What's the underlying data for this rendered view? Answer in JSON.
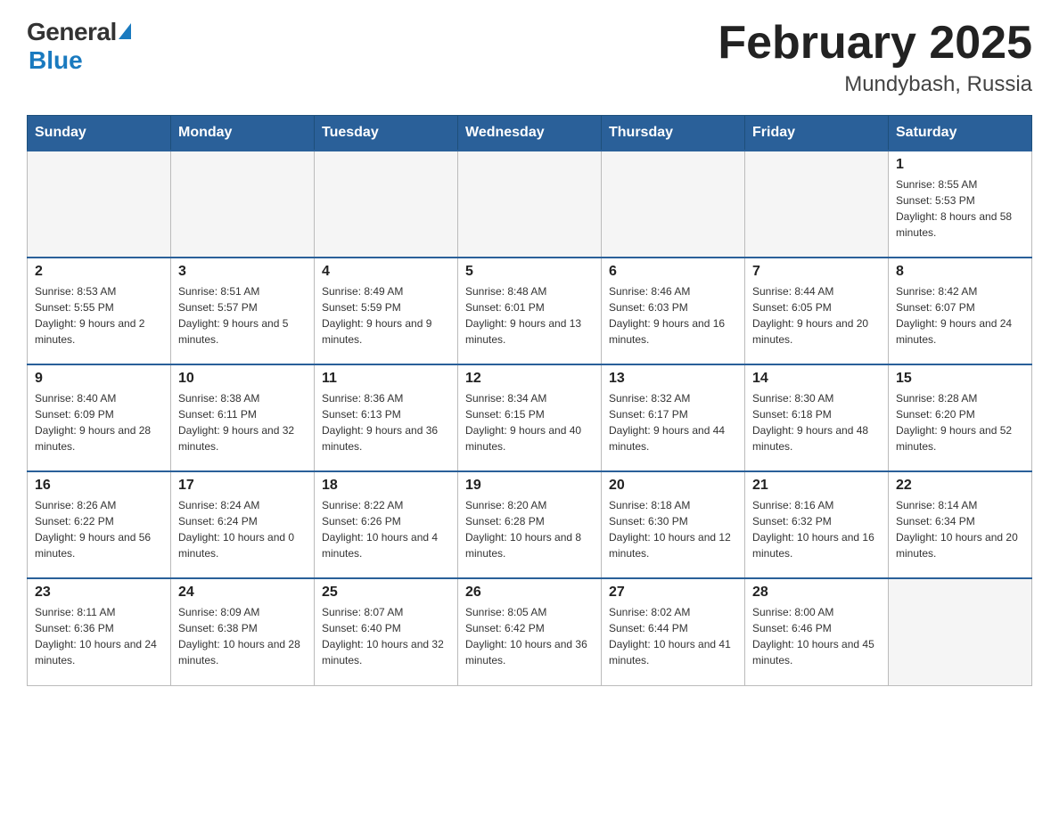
{
  "header": {
    "logo_general": "General",
    "logo_blue": "Blue",
    "title": "February 2025",
    "subtitle": "Mundybash, Russia"
  },
  "weekdays": [
    "Sunday",
    "Monday",
    "Tuesday",
    "Wednesday",
    "Thursday",
    "Friday",
    "Saturday"
  ],
  "weeks": [
    [
      {
        "day": "",
        "info": ""
      },
      {
        "day": "",
        "info": ""
      },
      {
        "day": "",
        "info": ""
      },
      {
        "day": "",
        "info": ""
      },
      {
        "day": "",
        "info": ""
      },
      {
        "day": "",
        "info": ""
      },
      {
        "day": "1",
        "info": "Sunrise: 8:55 AM\nSunset: 5:53 PM\nDaylight: 8 hours and 58 minutes."
      }
    ],
    [
      {
        "day": "2",
        "info": "Sunrise: 8:53 AM\nSunset: 5:55 PM\nDaylight: 9 hours and 2 minutes."
      },
      {
        "day": "3",
        "info": "Sunrise: 8:51 AM\nSunset: 5:57 PM\nDaylight: 9 hours and 5 minutes."
      },
      {
        "day": "4",
        "info": "Sunrise: 8:49 AM\nSunset: 5:59 PM\nDaylight: 9 hours and 9 minutes."
      },
      {
        "day": "5",
        "info": "Sunrise: 8:48 AM\nSunset: 6:01 PM\nDaylight: 9 hours and 13 minutes."
      },
      {
        "day": "6",
        "info": "Sunrise: 8:46 AM\nSunset: 6:03 PM\nDaylight: 9 hours and 16 minutes."
      },
      {
        "day": "7",
        "info": "Sunrise: 8:44 AM\nSunset: 6:05 PM\nDaylight: 9 hours and 20 minutes."
      },
      {
        "day": "8",
        "info": "Sunrise: 8:42 AM\nSunset: 6:07 PM\nDaylight: 9 hours and 24 minutes."
      }
    ],
    [
      {
        "day": "9",
        "info": "Sunrise: 8:40 AM\nSunset: 6:09 PM\nDaylight: 9 hours and 28 minutes."
      },
      {
        "day": "10",
        "info": "Sunrise: 8:38 AM\nSunset: 6:11 PM\nDaylight: 9 hours and 32 minutes."
      },
      {
        "day": "11",
        "info": "Sunrise: 8:36 AM\nSunset: 6:13 PM\nDaylight: 9 hours and 36 minutes."
      },
      {
        "day": "12",
        "info": "Sunrise: 8:34 AM\nSunset: 6:15 PM\nDaylight: 9 hours and 40 minutes."
      },
      {
        "day": "13",
        "info": "Sunrise: 8:32 AM\nSunset: 6:17 PM\nDaylight: 9 hours and 44 minutes."
      },
      {
        "day": "14",
        "info": "Sunrise: 8:30 AM\nSunset: 6:18 PM\nDaylight: 9 hours and 48 minutes."
      },
      {
        "day": "15",
        "info": "Sunrise: 8:28 AM\nSunset: 6:20 PM\nDaylight: 9 hours and 52 minutes."
      }
    ],
    [
      {
        "day": "16",
        "info": "Sunrise: 8:26 AM\nSunset: 6:22 PM\nDaylight: 9 hours and 56 minutes."
      },
      {
        "day": "17",
        "info": "Sunrise: 8:24 AM\nSunset: 6:24 PM\nDaylight: 10 hours and 0 minutes."
      },
      {
        "day": "18",
        "info": "Sunrise: 8:22 AM\nSunset: 6:26 PM\nDaylight: 10 hours and 4 minutes."
      },
      {
        "day": "19",
        "info": "Sunrise: 8:20 AM\nSunset: 6:28 PM\nDaylight: 10 hours and 8 minutes."
      },
      {
        "day": "20",
        "info": "Sunrise: 8:18 AM\nSunset: 6:30 PM\nDaylight: 10 hours and 12 minutes."
      },
      {
        "day": "21",
        "info": "Sunrise: 8:16 AM\nSunset: 6:32 PM\nDaylight: 10 hours and 16 minutes."
      },
      {
        "day": "22",
        "info": "Sunrise: 8:14 AM\nSunset: 6:34 PM\nDaylight: 10 hours and 20 minutes."
      }
    ],
    [
      {
        "day": "23",
        "info": "Sunrise: 8:11 AM\nSunset: 6:36 PM\nDaylight: 10 hours and 24 minutes."
      },
      {
        "day": "24",
        "info": "Sunrise: 8:09 AM\nSunset: 6:38 PM\nDaylight: 10 hours and 28 minutes."
      },
      {
        "day": "25",
        "info": "Sunrise: 8:07 AM\nSunset: 6:40 PM\nDaylight: 10 hours and 32 minutes."
      },
      {
        "day": "26",
        "info": "Sunrise: 8:05 AM\nSunset: 6:42 PM\nDaylight: 10 hours and 36 minutes."
      },
      {
        "day": "27",
        "info": "Sunrise: 8:02 AM\nSunset: 6:44 PM\nDaylight: 10 hours and 41 minutes."
      },
      {
        "day": "28",
        "info": "Sunrise: 8:00 AM\nSunset: 6:46 PM\nDaylight: 10 hours and 45 minutes."
      },
      {
        "day": "",
        "info": ""
      }
    ]
  ]
}
